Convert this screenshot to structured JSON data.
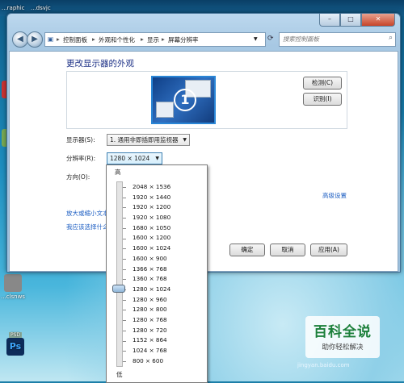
{
  "desktop": {
    "top_labels": [
      "...raphic",
      "...dsvjc"
    ],
    "side_label": "...clsnws",
    "ps_label": "PSD",
    "ps_icon": "Ps"
  },
  "window": {
    "caption": {
      "minimize": "–",
      "maximize": "□",
      "close": "✕"
    },
    "address": {
      "crumbs": [
        "控制面板",
        "外观和个性化",
        "显示",
        "屏幕分辨率"
      ],
      "separator": "▸",
      "search_placeholder": "搜索控制面板"
    },
    "title": "更改显示器的外观",
    "detect_button": "检测(C)",
    "identify_button": "识别(I)",
    "monitor_number": "1",
    "display_label": "显示器(S):",
    "display_value": "1. 通用非即插即用监视器",
    "resolution_label": "分辨率(R):",
    "resolution_value": "1280 × 1024",
    "orientation_label": "方向(O):",
    "advanced_link": "高级设置",
    "link_text_size": "放大或缩小文本",
    "link_choose": "我应该选择什么",
    "ok_button": "确定",
    "cancel_button": "取消",
    "apply_button": "应用(A)"
  },
  "dropdown": {
    "high_label": "高",
    "low_label": "低",
    "selected_index": 11,
    "resolutions": [
      "2048 × 1536",
      "1920 × 1440",
      "1920 × 1200",
      "1920 × 1080",
      "1680 × 1050",
      "1600 × 1200",
      "1600 × 1024",
      "1600 × 900",
      "1366 × 768",
      "1360 × 768",
      "1280 × 1024",
      "1280 × 960",
      "1280 × 800",
      "1280 × 768",
      "1280 × 720",
      "1152 × 864",
      "1024 × 768",
      "800 × 600"
    ]
  },
  "watermark": {
    "brand": "百科全说",
    "tagline": "助你轻松解决",
    "url": "jingyan.baidu.com"
  }
}
